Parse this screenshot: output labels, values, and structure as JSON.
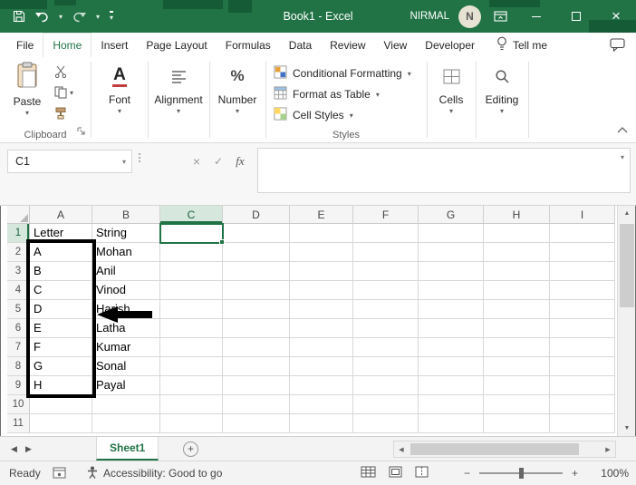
{
  "window": {
    "title": "Book1  -  Excel",
    "user_name": "NIRMAL",
    "user_initial": "N"
  },
  "colors": {
    "accent": "#217346",
    "titlebar_bg": "#217346",
    "annotation": "#000000"
  },
  "ribbon": {
    "tabs": [
      {
        "label": "File"
      },
      {
        "label": "Home",
        "active": true
      },
      {
        "label": "Insert"
      },
      {
        "label": "Page Layout"
      },
      {
        "label": "Formulas"
      },
      {
        "label": "Data"
      },
      {
        "label": "Review"
      },
      {
        "label": "View"
      },
      {
        "label": "Developer"
      }
    ],
    "tellme_label": "Tell me",
    "clipboard": {
      "paste_label": "Paste",
      "group_label": "Clipboard"
    },
    "font": {
      "group_label": "Font"
    },
    "alignment": {
      "group_label": "Alignment"
    },
    "number": {
      "group_label": "Number"
    },
    "styles": {
      "conditional_formatting": "Conditional Formatting",
      "format_as_table": "Format as Table",
      "cell_styles": "Cell Styles",
      "group_label": "Styles"
    },
    "cells": {
      "group_label": "Cells"
    },
    "editing": {
      "group_label": "Editing"
    }
  },
  "formula_bar": {
    "name_box": "C1",
    "fx_label": "fx",
    "value": ""
  },
  "grid": {
    "col_headers": [
      "A",
      "B",
      "C",
      "D",
      "E",
      "F",
      "G",
      "H",
      "I"
    ],
    "row_count": 11,
    "selected_cell": "C1",
    "highlight_col": "C",
    "highlight_row": "1",
    "data": {
      "A1": "Letter",
      "B1": "String",
      "A2": "A",
      "B2": "Mohan",
      "A3": "B",
      "B3": "Anil",
      "A4": "C",
      "B4": "Vinod",
      "A5": "D",
      "B5": "Harish",
      "A6": "E",
      "B6": "Latha",
      "A7": "F",
      "B7": "Kumar",
      "A8": "G",
      "B8": "Sonal",
      "A9": "H",
      "B9": "Payal"
    }
  },
  "sheet_bar": {
    "sheet_name": "Sheet1"
  },
  "status_bar": {
    "ready_label": "Ready",
    "accessibility_label": "Accessibility: Good to go",
    "zoom_label": "100%"
  }
}
